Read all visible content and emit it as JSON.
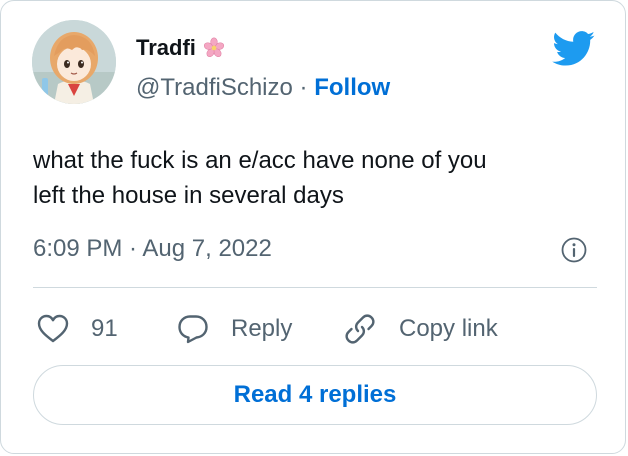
{
  "author": {
    "name": "Tradfi",
    "name_emoji": "cherry-blossom-icon",
    "handle": "@TradfiSchizo",
    "separator": "·",
    "follow_label": "Follow",
    "avatar_icon": "anime-girl-avatar"
  },
  "tweet": {
    "text_line1": "what the fuck is an e/acc have none of you",
    "text_line2": "left the house in several days",
    "timestamp": "6:09 PM · Aug 7, 2022"
  },
  "actions": {
    "like_count": "91",
    "reply_label": "Reply",
    "copy_link_label": "Copy link"
  },
  "footer": {
    "read_replies_label": "Read 4 replies"
  },
  "colors": {
    "accent": "#006fd6",
    "twitter_blue": "#1d9bf0",
    "text": "#0f1419",
    "muted": "#536471",
    "border": "#cfd9de",
    "blossom": "#f4a7c3"
  }
}
